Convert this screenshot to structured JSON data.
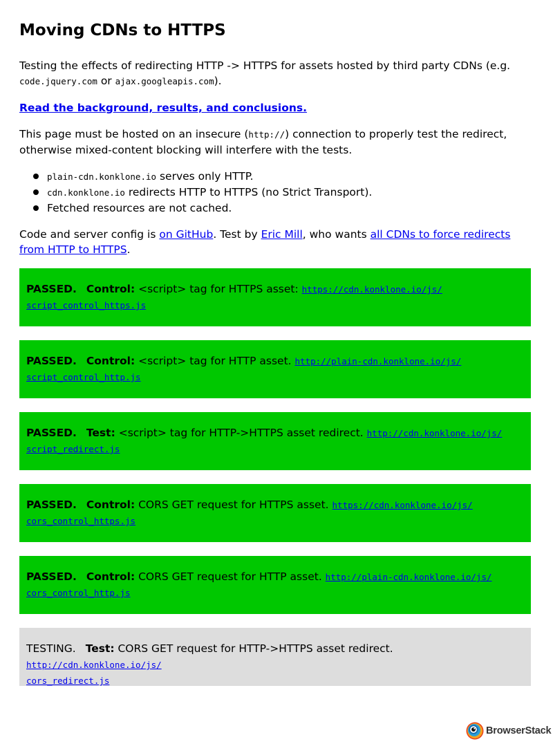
{
  "page": {
    "title": "Moving CDNs to HTTPS",
    "intro": {
      "text_1": "Testing the effects of redirecting HTTP -> HTTPS for assets hosted by third party CDNs (e.g. ",
      "code_1": "code.jquery.com",
      "text_2": " or ",
      "code_2": "ajax.googleapis.com",
      "text_3": ")."
    },
    "background_link": "Read the background, results, and conclusions.",
    "insecure_note": {
      "text_1": "This page must be hosted on an insecure (",
      "code": "http://",
      "text_2": ") connection to properly test the redirect, otherwise mixed-content blocking will interfere with the tests."
    },
    "bullets": [
      {
        "code": "plain-cdn.konklone.io",
        "text": " serves only HTTP."
      },
      {
        "code": "cdn.konklone.io",
        "text": " redirects HTTP to HTTPS (no Strict Transport)."
      },
      {
        "code": "",
        "text": "Fetched resources are not cached."
      }
    ],
    "credits": {
      "text_1": "Code and server config is ",
      "link_github": "on GitHub",
      "text_2": ". Test by ",
      "link_author": "Eric Mill",
      "text_3": ", who wants ",
      "link_cdns": "all CDNs to force redirects from HTTP to HTTPS",
      "text_4": "."
    }
  },
  "tests": [
    {
      "status": "PASSED.",
      "kind": "Control:",
      "desc": " <script> tag for HTTPS asset: ",
      "url_1": "https://cdn.konklone.io/js/",
      "url_2": "script_control_https.js"
    },
    {
      "status": "PASSED.",
      "kind": "Control:",
      "desc": " <script> tag for HTTP asset. ",
      "url_1": "http://plain-cdn.konklone.io/js/",
      "url_2": "script_control_http.js"
    },
    {
      "status": "PASSED.",
      "kind": "Test:",
      "desc": " <script> tag for HTTP->HTTPS asset redirect. ",
      "url_1": "http://cdn.konklone.io/js/",
      "url_2": "script_redirect.js"
    },
    {
      "status": "PASSED.",
      "kind": "Control:",
      "desc": " CORS GET request for HTTPS asset. ",
      "url_1": "https://cdn.konklone.io/js/",
      "url_2": "cors_control_https.js"
    },
    {
      "status": "PASSED.",
      "kind": "Control:",
      "desc": " CORS GET request for HTTP asset. ",
      "url_1": "http://plain-cdn.konklone.io/js/",
      "url_2": "cors_control_http.js"
    },
    {
      "status": "TESTING.",
      "kind": "Test:",
      "desc": " CORS GET request for HTTP->HTTPS asset redirect. ",
      "url_1": "http://cdn.konklone.io/js/",
      "url_2": "cors_redirect.js"
    }
  ],
  "colors": {
    "passed": "#00c800",
    "testing": "#dddddd",
    "link": "#0000ee"
  },
  "watermark": {
    "brand": "BrowserStack"
  }
}
